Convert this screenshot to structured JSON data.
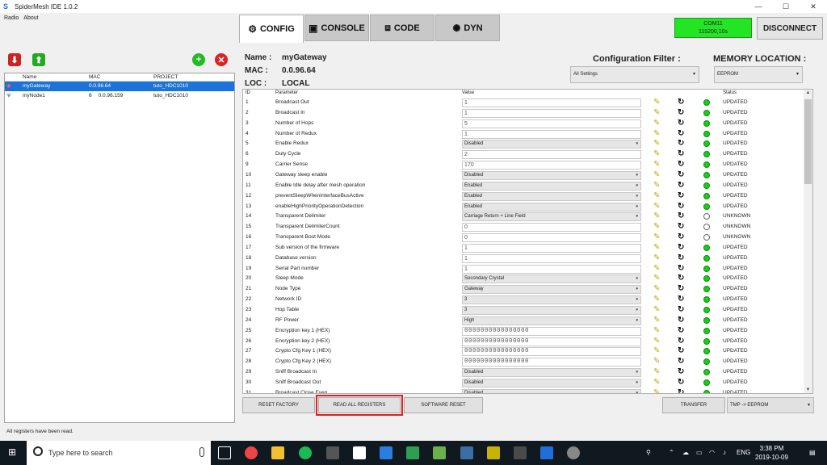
{
  "window": {
    "title": "SpiderMesh IDE 1.0.2",
    "logo": "S",
    "controls": [
      "—",
      "☐",
      "✕"
    ]
  },
  "menu": [
    "Radio",
    "About"
  ],
  "tabs": [
    {
      "label": "CONFIG",
      "icon": "⚙",
      "icon_name": "gear-icon",
      "active": true
    },
    {
      "label": "CONSOLE",
      "icon": "▣",
      "icon_name": "console-icon",
      "active": false
    },
    {
      "label": "CODE",
      "icon": "⧈",
      "icon_name": "code-icon",
      "active": false
    },
    {
      "label": "DYN",
      "icon": "✺",
      "icon_name": "network-icon",
      "active": false
    }
  ],
  "connection": {
    "port": "COM11",
    "baud": "115200,10s",
    "color": "#23e523"
  },
  "disconnect_label": "DISCONNECT",
  "node_table": {
    "columns": [
      "Name",
      "MAC",
      "PROJECT"
    ],
    "rows": [
      {
        "icon": "gateway-icon",
        "name": "myGateway",
        "mac": "0.0.96.64",
        "project": "tuto_HDC1010",
        "selected": true
      },
      {
        "icon": "wifi-icon",
        "name": "myNode1",
        "mac": "0.0.96.159",
        "project": "tuto_HDC1010",
        "selected": false,
        "badge": "0"
      }
    ]
  },
  "status_bar": "All registers have been read.",
  "device": {
    "name_label": "Name :",
    "name": "myGateway",
    "mac_label": "MAC :",
    "mac": "0.0.96.64",
    "loc_label": "LOC :",
    "loc": "LOCAL"
  },
  "config_filter": {
    "label": "Configuration Filter :",
    "value": "All Settings"
  },
  "memory_location": {
    "label": "MEMORY LOCATION :",
    "value": "EEPROM"
  },
  "reg_columns": {
    "id": "ID",
    "parameter": "Parameter",
    "value": "Value",
    "status": "Status"
  },
  "registers": [
    {
      "id": "1",
      "param": "Broadcast Out",
      "value": "1",
      "kind": "text",
      "status": "UPDATED"
    },
    {
      "id": "2",
      "param": "Broadcast In",
      "value": "1",
      "kind": "text",
      "status": "UPDATED"
    },
    {
      "id": "3",
      "param": "Number of Hops",
      "value": "5",
      "kind": "text",
      "status": "UPDATED"
    },
    {
      "id": "4",
      "param": "Number of Redux",
      "value": "1",
      "kind": "text",
      "status": "UPDATED"
    },
    {
      "id": "5",
      "param": "Enable Redux",
      "value": "Disabled",
      "kind": "select",
      "status": "UPDATED"
    },
    {
      "id": "6",
      "param": "Duty Cycle",
      "value": "2",
      "kind": "text",
      "status": "UPDATED"
    },
    {
      "id": "9",
      "param": "Carrier Sense",
      "value": "170",
      "kind": "text",
      "status": "UPDATED"
    },
    {
      "id": "10",
      "param": "Gateway sleep enable",
      "value": "Disabled",
      "kind": "select",
      "status": "UPDATED"
    },
    {
      "id": "11",
      "param": "Enable Idle delay after mesh operation",
      "value": "Enabled",
      "kind": "select",
      "status": "UPDATED"
    },
    {
      "id": "12",
      "param": "preventSleepWhenInterfaceBusActive",
      "value": "Enabled",
      "kind": "select",
      "status": "UPDATED"
    },
    {
      "id": "13",
      "param": "enableHighPriorityOperationDetection",
      "value": "Enabled",
      "kind": "select",
      "status": "UPDATED"
    },
    {
      "id": "14",
      "param": "Transparent Delimiter",
      "value": "Carriage Return + Line Field",
      "kind": "select",
      "status": "UNKNOWN"
    },
    {
      "id": "15",
      "param": "Transparent DelimiterCount",
      "value": "0",
      "kind": "text",
      "status": "UNKNOWN"
    },
    {
      "id": "16",
      "param": "Transparent Boot Mode",
      "value": "0",
      "kind": "text",
      "status": "UNKNOWN"
    },
    {
      "id": "17",
      "param": "Sub version of the firmware",
      "value": "1",
      "kind": "text",
      "status": "UPDATED"
    },
    {
      "id": "18",
      "param": "Database version",
      "value": "1",
      "kind": "text",
      "status": "UPDATED"
    },
    {
      "id": "19",
      "param": "Serial Part number",
      "value": "1",
      "kind": "text",
      "status": "UPDATED"
    },
    {
      "id": "20",
      "param": "Sleep Mode",
      "value": "Secondary Crystal",
      "kind": "select",
      "status": "UPDATED"
    },
    {
      "id": "21",
      "param": "Node Type",
      "value": "Gateway",
      "kind": "select",
      "status": "UPDATED"
    },
    {
      "id": "22",
      "param": "Network ID",
      "value": "3",
      "kind": "select",
      "status": "UPDATED"
    },
    {
      "id": "23",
      "param": "Hop Table",
      "value": "3",
      "kind": "select",
      "status": "UPDATED"
    },
    {
      "id": "24",
      "param": "RF Power",
      "value": "High",
      "kind": "select",
      "status": "UPDATED"
    },
    {
      "id": "25",
      "param": "Encryption key 1 (HEX)",
      "value": "0000000000000000",
      "kind": "hex",
      "status": "UPDATED"
    },
    {
      "id": "26",
      "param": "Encryption key 2 (HEX)",
      "value": "0000000000000000",
      "kind": "hex",
      "status": "UPDATED"
    },
    {
      "id": "27",
      "param": "Crypto Cfg Key 1 (HEX)",
      "value": "0000000000000000",
      "kind": "hex",
      "status": "UPDATED"
    },
    {
      "id": "28",
      "param": "Crypto Cfg Key 2 (HEX)",
      "value": "0000000000000000",
      "kind": "hex",
      "status": "UPDATED"
    },
    {
      "id": "29",
      "param": "Sniff Broadcast In",
      "value": "Disabled",
      "kind": "select",
      "status": "UPDATED"
    },
    {
      "id": "30",
      "param": "Sniff Broadcast Out",
      "value": "Disabled",
      "kind": "select",
      "status": "UPDATED"
    },
    {
      "id": "31",
      "param": "Broadcast Close Even",
      "value": "Disabled",
      "kind": "select",
      "status": "UPDATED"
    }
  ],
  "status_colors": {
    "UPDATED": "#18d018",
    "UNKNOWN": "#ffffff"
  },
  "buttons": {
    "reset_factory": "RESET FACTORY",
    "read_all": "READ ALL REGISTERS",
    "software_reset": "SOFTWARE RESET",
    "transfer": "TRANSFER",
    "transfer_mode": "TMP -> EEPROM"
  },
  "taskbar": {
    "search_placeholder": "Type here to search",
    "time": "3:38 PM",
    "date": "2019-10-09",
    "lang": "ENG"
  }
}
